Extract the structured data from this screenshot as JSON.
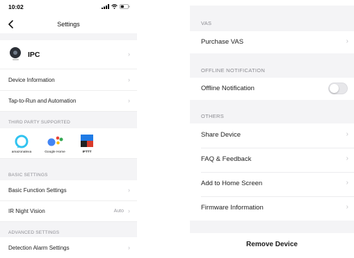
{
  "status_bar": {
    "time": "10:02"
  },
  "nav": {
    "title": "Settings"
  },
  "device": {
    "name": "IPC"
  },
  "left_rows": {
    "device_information": "Device Information",
    "tap_to_run": "Tap-to-Run and Automation",
    "basic_function": "Basic Function Settings",
    "ir_night_vision": "IR Night Vision",
    "ir_night_vision_value": "Auto",
    "detection_alarm": "Detection Alarm Settings"
  },
  "sections_left": {
    "third_party": "THIRD PARTY SUPPORTED",
    "basic": "BASIC SETTINGS",
    "advanced": "ADVANCED SETTINGS"
  },
  "third_party": [
    {
      "name": "amazon-alexa",
      "caption": "amazonalexa"
    },
    {
      "name": "google-home",
      "caption": "Google Home"
    },
    {
      "name": "ifttt",
      "caption": "IFTTT"
    }
  ],
  "right": {
    "section_vas": "VAS",
    "purchase_vas": "Purchase VAS",
    "section_offline": "OFFLINE NOTIFICATION",
    "offline_notification": "Offline Notification",
    "offline_notification_enabled": false,
    "section_others": "OTHERS",
    "share_device": "Share Device",
    "faq": "FAQ & Feedback",
    "add_home": "Add to Home Screen",
    "firmware": "Firmware Information",
    "remove_device": "Remove Device"
  },
  "colors": {
    "alexa": "#31c3f0",
    "google_blue": "#4285f4",
    "google_red": "#ea4335",
    "google_yellow": "#fbbc05",
    "google_green": "#34a853",
    "ifttt_blue": "#1f7be5",
    "background_gray": "#f4f4f6"
  }
}
